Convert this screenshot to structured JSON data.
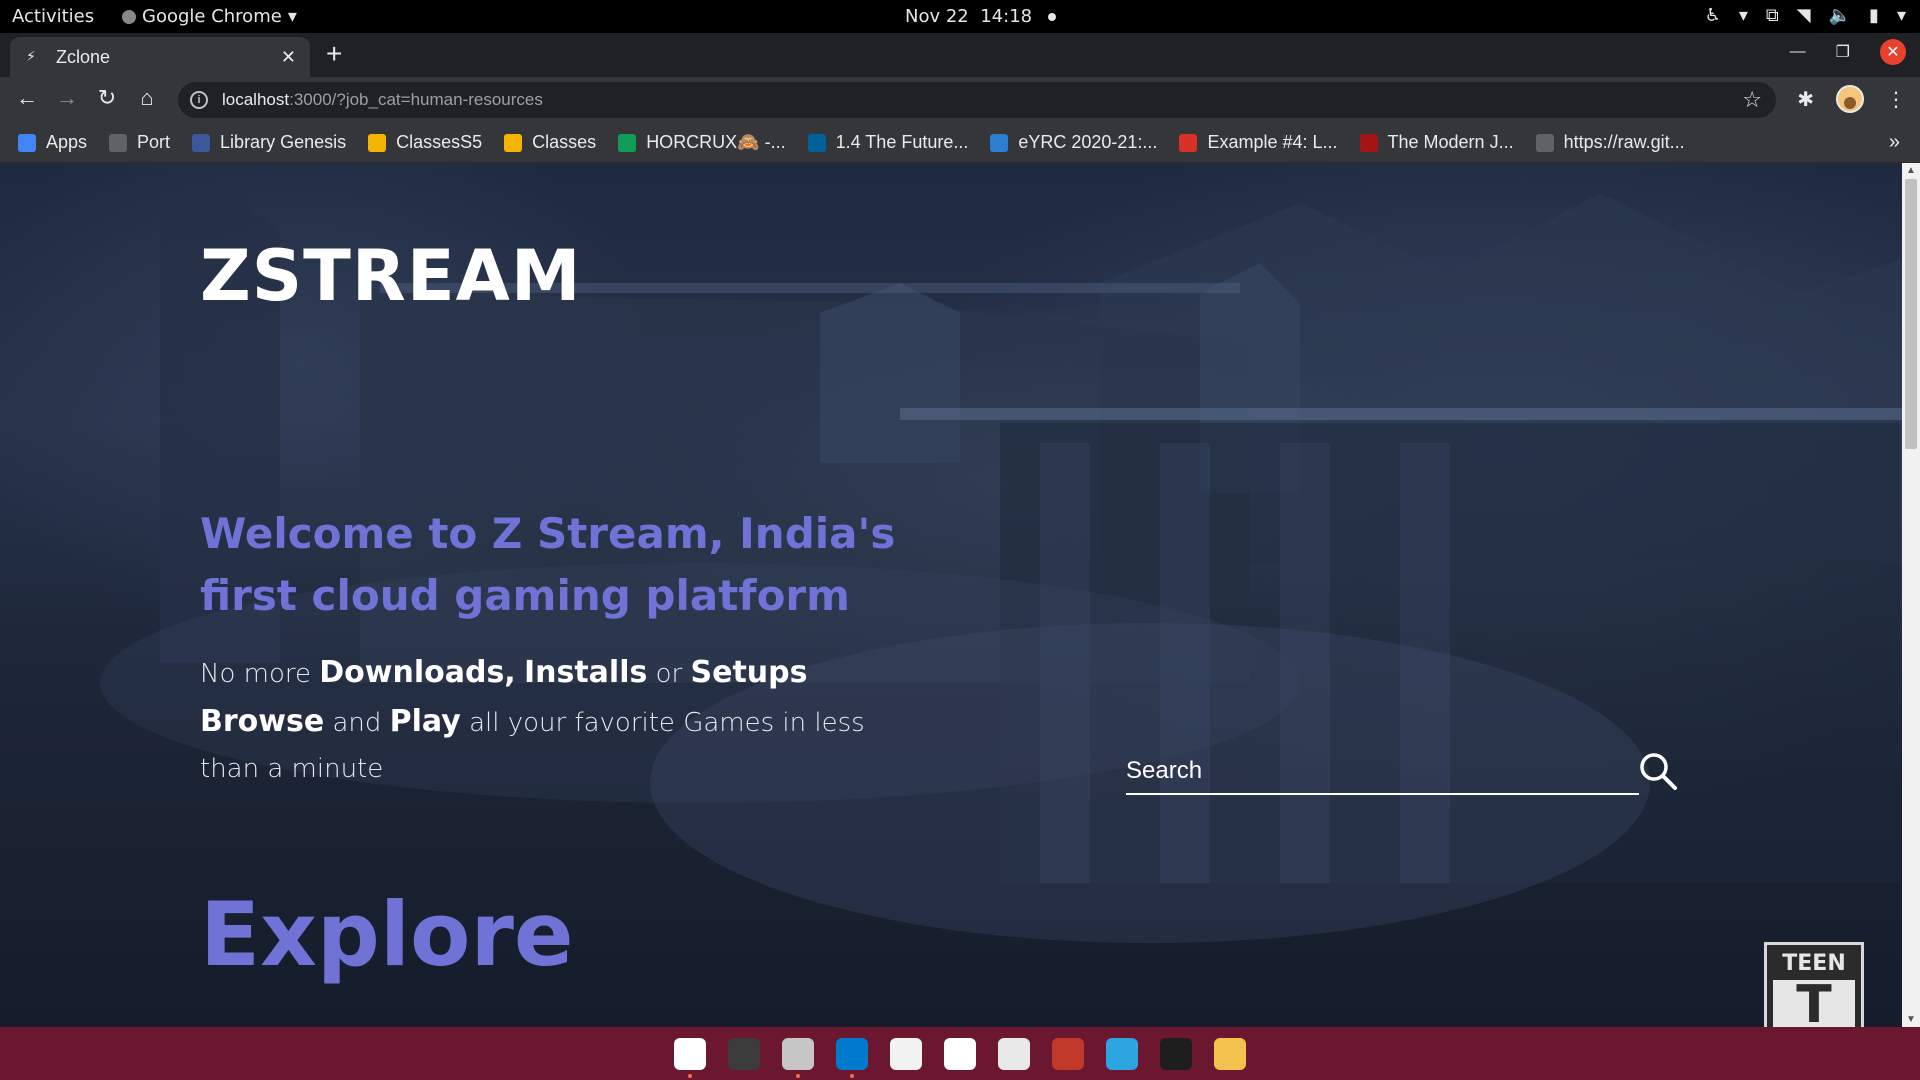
{
  "system_bar": {
    "activities": "Activities",
    "app_menu": "Google Chrome",
    "date": "Nov 22",
    "time": "14:18"
  },
  "browser": {
    "tab_title": "Zclone",
    "url_host": "localhost",
    "url_path": ":3000/?job_cat=human-resources",
    "bookmarks": [
      {
        "label": "Apps",
        "icon": "apps-grid-icon",
        "color": "#4285f4"
      },
      {
        "label": "Port",
        "icon": "globe-icon",
        "color": "#5f6368"
      },
      {
        "label": "Library Genesis",
        "icon": "library-icon",
        "color": "#3b5998"
      },
      {
        "label": "ClassesS5",
        "icon": "classroom-icon",
        "color": "#f4b400"
      },
      {
        "label": "Classes",
        "icon": "classroom-icon",
        "color": "#f4b400"
      },
      {
        "label": "HORCRUX🙈 -...",
        "icon": "drive-icon",
        "color": "#0f9d58"
      },
      {
        "label": "1.4 The Future...",
        "icon": "ieee-icon",
        "color": "#00629b"
      },
      {
        "label": "eYRC 2020-21:...",
        "icon": "p-icon",
        "color": "#2d7dd2"
      },
      {
        "label": "Example #4: L...",
        "icon": "e-icon",
        "color": "#d93025"
      },
      {
        "label": "The Modern J...",
        "icon": "js-icon",
        "color": "#a31515"
      },
      {
        "label": "https://raw.git...",
        "icon": "globe-icon",
        "color": "#5f6368"
      }
    ]
  },
  "page": {
    "brand": "ZSTREAM",
    "headline": "Welcome to Z Stream, India's first cloud gaming platform",
    "tagline": {
      "part1": "No more",
      "downloads": "Downloads,",
      "installs": "Installs",
      "or": "or",
      "setups": "Setups",
      "browse": "Browse",
      "and": "and",
      "play": "Play",
      "rest": "all your favorite Games in less than a minute"
    },
    "search_placeholder": "Search",
    "explore": "Explore",
    "rating_badge": "TEEN",
    "rating_letter": "T",
    "accent_color": "#7072d6"
  },
  "dock": [
    {
      "name": "chrome",
      "color": "#ffffff",
      "running": true
    },
    {
      "name": "terminal",
      "color": "#3c3c3c",
      "running": false
    },
    {
      "name": "files",
      "color": "#c6c6c6",
      "running": true
    },
    {
      "name": "vscode",
      "color": "#007acc",
      "running": true
    },
    {
      "name": "text-editor",
      "color": "#f2f2f2",
      "running": false
    },
    {
      "name": "notion",
      "color": "#ffffff",
      "running": false
    },
    {
      "name": "document-viewer",
      "color": "#e8e8e8",
      "running": false
    },
    {
      "name": "cherry",
      "color": "#c0392b",
      "running": false
    },
    {
      "name": "telegram",
      "color": "#2ca5e0",
      "running": false
    },
    {
      "name": "figma",
      "color": "#1e1e1e",
      "running": false
    },
    {
      "name": "teapot",
      "color": "#f2c14e",
      "running": false
    }
  ]
}
